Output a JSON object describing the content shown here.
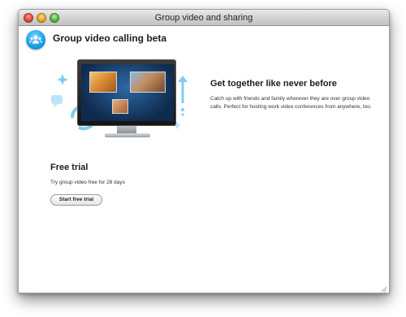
{
  "window": {
    "title": "Group video and sharing"
  },
  "header": {
    "title": "Group video calling beta",
    "logo_icon": "group-people-icon"
  },
  "promo": {
    "heading": "Get together like never before",
    "text": "Catch up with friends and family wherever they are over group video calls. Perfect for hosting work video conferences from anywhere, too."
  },
  "trial": {
    "title": "Free trial",
    "text": "Try group video free for 28 days",
    "button_label": "Start free trial"
  },
  "colors": {
    "accent": "#1ea0e8",
    "decor": "#7fcdf3",
    "screen": "#1a4a80"
  }
}
